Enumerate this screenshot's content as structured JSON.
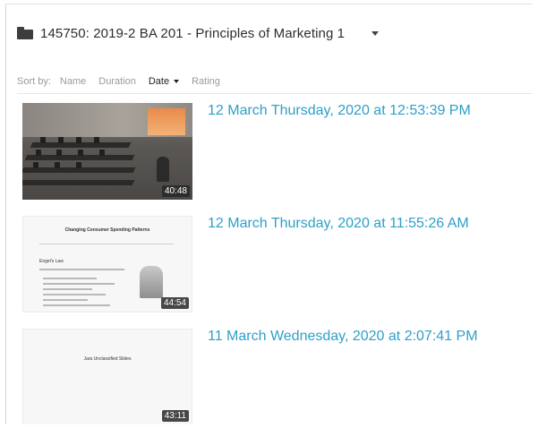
{
  "header": {
    "title": "145750: 2019-2 BA 201 - Principles of Marketing 1"
  },
  "sort": {
    "label": "Sort by:",
    "options": [
      "Name",
      "Duration",
      "Date",
      "Rating"
    ],
    "active": "Date"
  },
  "sessions": [
    {
      "date": "12 March Thursday, 2020 at 12:53:39 PM",
      "duration": "40:48"
    },
    {
      "date": "12 March Thursday, 2020 at 11:55:26 AM",
      "duration": "44:54",
      "slide_title": "Changing Consumer Spending Patterns",
      "slide_heading": "Engel's Law"
    },
    {
      "date": "11 March Wednesday, 2020 at 2:07:41 PM",
      "duration": "43:11",
      "slide_title": "Jara Unclassified Slides"
    }
  ],
  "colors": {
    "link": "#2ea0c8",
    "text": "#2e2e2e",
    "muted": "#9a9a9a"
  }
}
